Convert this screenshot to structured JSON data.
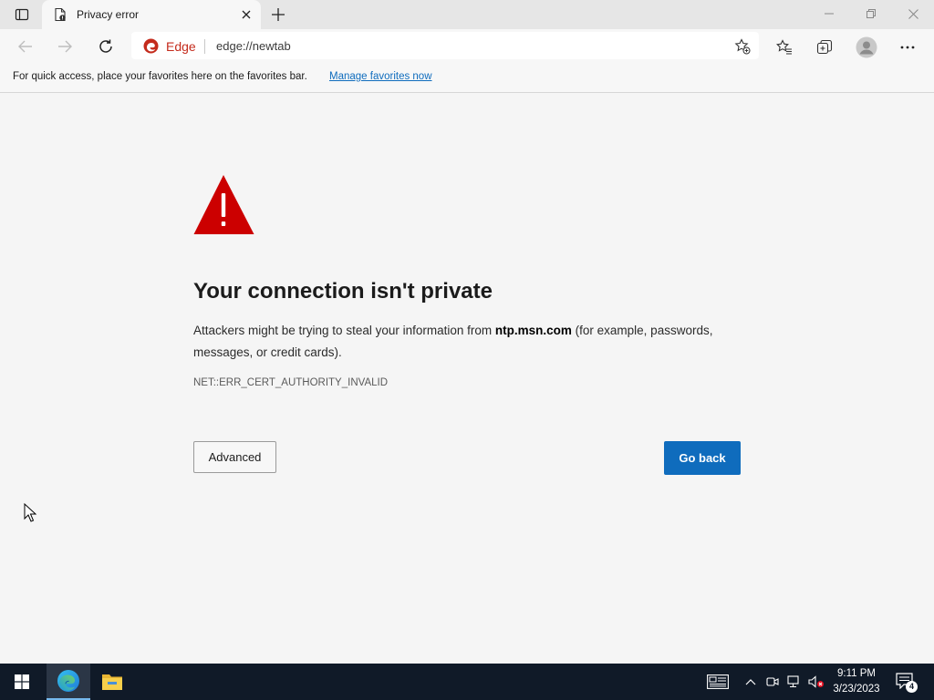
{
  "tab": {
    "title": "Privacy error"
  },
  "address": {
    "brand": "Edge",
    "url": "edge://newtab"
  },
  "favorites_bar": {
    "message": "For quick access, place your favorites here on the favorites bar.",
    "link": "Manage favorites now"
  },
  "error": {
    "heading": "Your connection isn't private",
    "desc_before": "Attackers might be trying to steal your information from ",
    "host": "ntp.msn.com",
    "desc_after": " (for example, passwords, messages, or credit cards).",
    "code": "NET::ERR_CERT_AUTHORITY_INVALID",
    "advanced_label": "Advanced",
    "goback_label": "Go back"
  },
  "taskbar": {
    "time": "9:11 PM",
    "date": "3/23/2023",
    "notification_count": "4"
  },
  "colors": {
    "accent": "#0f6cbd",
    "warning_red": "#cc0000",
    "taskbar_bg": "#101a28"
  }
}
